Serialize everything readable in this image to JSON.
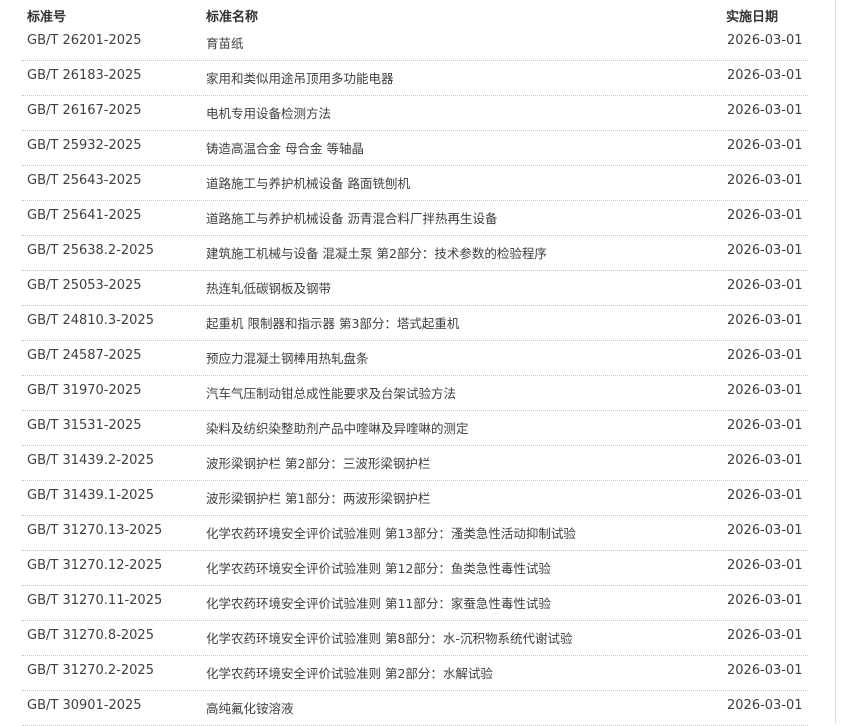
{
  "table": {
    "headers": {
      "code": "标准号",
      "name": "标准名称",
      "date": "实施日期"
    },
    "rows": [
      {
        "code": "GB/T 26201-2025",
        "name": "育苗纸",
        "date": "2026-03-01"
      },
      {
        "code": "GB/T 26183-2025",
        "name": "家用和类似用途吊顶用多功能电器",
        "date": "2026-03-01"
      },
      {
        "code": "GB/T 26167-2025",
        "name": "电机专用设备检测方法",
        "date": "2026-03-01"
      },
      {
        "code": "GB/T 25932-2025",
        "name": "铸造高温合金 母合金 等轴晶",
        "date": "2026-03-01"
      },
      {
        "code": "GB/T 25643-2025",
        "name": "道路施工与养护机械设备 路面铣刨机",
        "date": "2026-03-01"
      },
      {
        "code": "GB/T 25641-2025",
        "name": "道路施工与养护机械设备 沥青混合料厂拌热再生设备",
        "date": "2026-03-01"
      },
      {
        "code": "GB/T 25638.2-2025",
        "name": "建筑施工机械与设备 混凝土泵 第2部分：技术参数的检验程序",
        "date": "2026-03-01"
      },
      {
        "code": "GB/T 25053-2025",
        "name": "热连轧低碳钢板及钢带",
        "date": "2026-03-01"
      },
      {
        "code": "GB/T 24810.3-2025",
        "name": "起重机 限制器和指示器 第3部分：塔式起重机",
        "date": "2026-03-01"
      },
      {
        "code": "GB/T 24587-2025",
        "name": "预应力混凝土钢棒用热轧盘条",
        "date": "2026-03-01"
      },
      {
        "code": "GB/T 31970-2025",
        "name": "汽车气压制动钳总成性能要求及台架试验方法",
        "date": "2026-03-01"
      },
      {
        "code": "GB/T 31531-2025",
        "name": "染料及纺织染整助剂产品中喹啉及异喹啉的测定",
        "date": "2026-03-01"
      },
      {
        "code": "GB/T 31439.2-2025",
        "name": "波形梁钢护栏 第2部分：三波形梁钢护栏",
        "date": "2026-03-01"
      },
      {
        "code": "GB/T 31439.1-2025",
        "name": "波形梁钢护栏 第1部分：两波形梁钢护栏",
        "date": "2026-03-01"
      },
      {
        "code": "GB/T 31270.13-2025",
        "name": "化学农药环境安全评价试验准则 第13部分：溞类急性活动抑制试验",
        "date": "2026-03-01"
      },
      {
        "code": "GB/T 31270.12-2025",
        "name": "化学农药环境安全评价试验准则 第12部分：鱼类急性毒性试验",
        "date": "2026-03-01"
      },
      {
        "code": "GB/T 31270.11-2025",
        "name": "化学农药环境安全评价试验准则 第11部分：家蚕急性毒性试验",
        "date": "2026-03-01"
      },
      {
        "code": "GB/T 31270.8-2025",
        "name": "化学农药环境安全评价试验准则 第8部分：水-沉积物系统代谢试验",
        "date": "2026-03-01"
      },
      {
        "code": "GB/T 31270.2-2025",
        "name": "化学农药环境安全评价试验准则 第2部分：水解试验",
        "date": "2026-03-01"
      },
      {
        "code": "GB/T 30901-2025",
        "name": "高纯氟化铵溶液",
        "date": "2026-03-01"
      }
    ]
  }
}
